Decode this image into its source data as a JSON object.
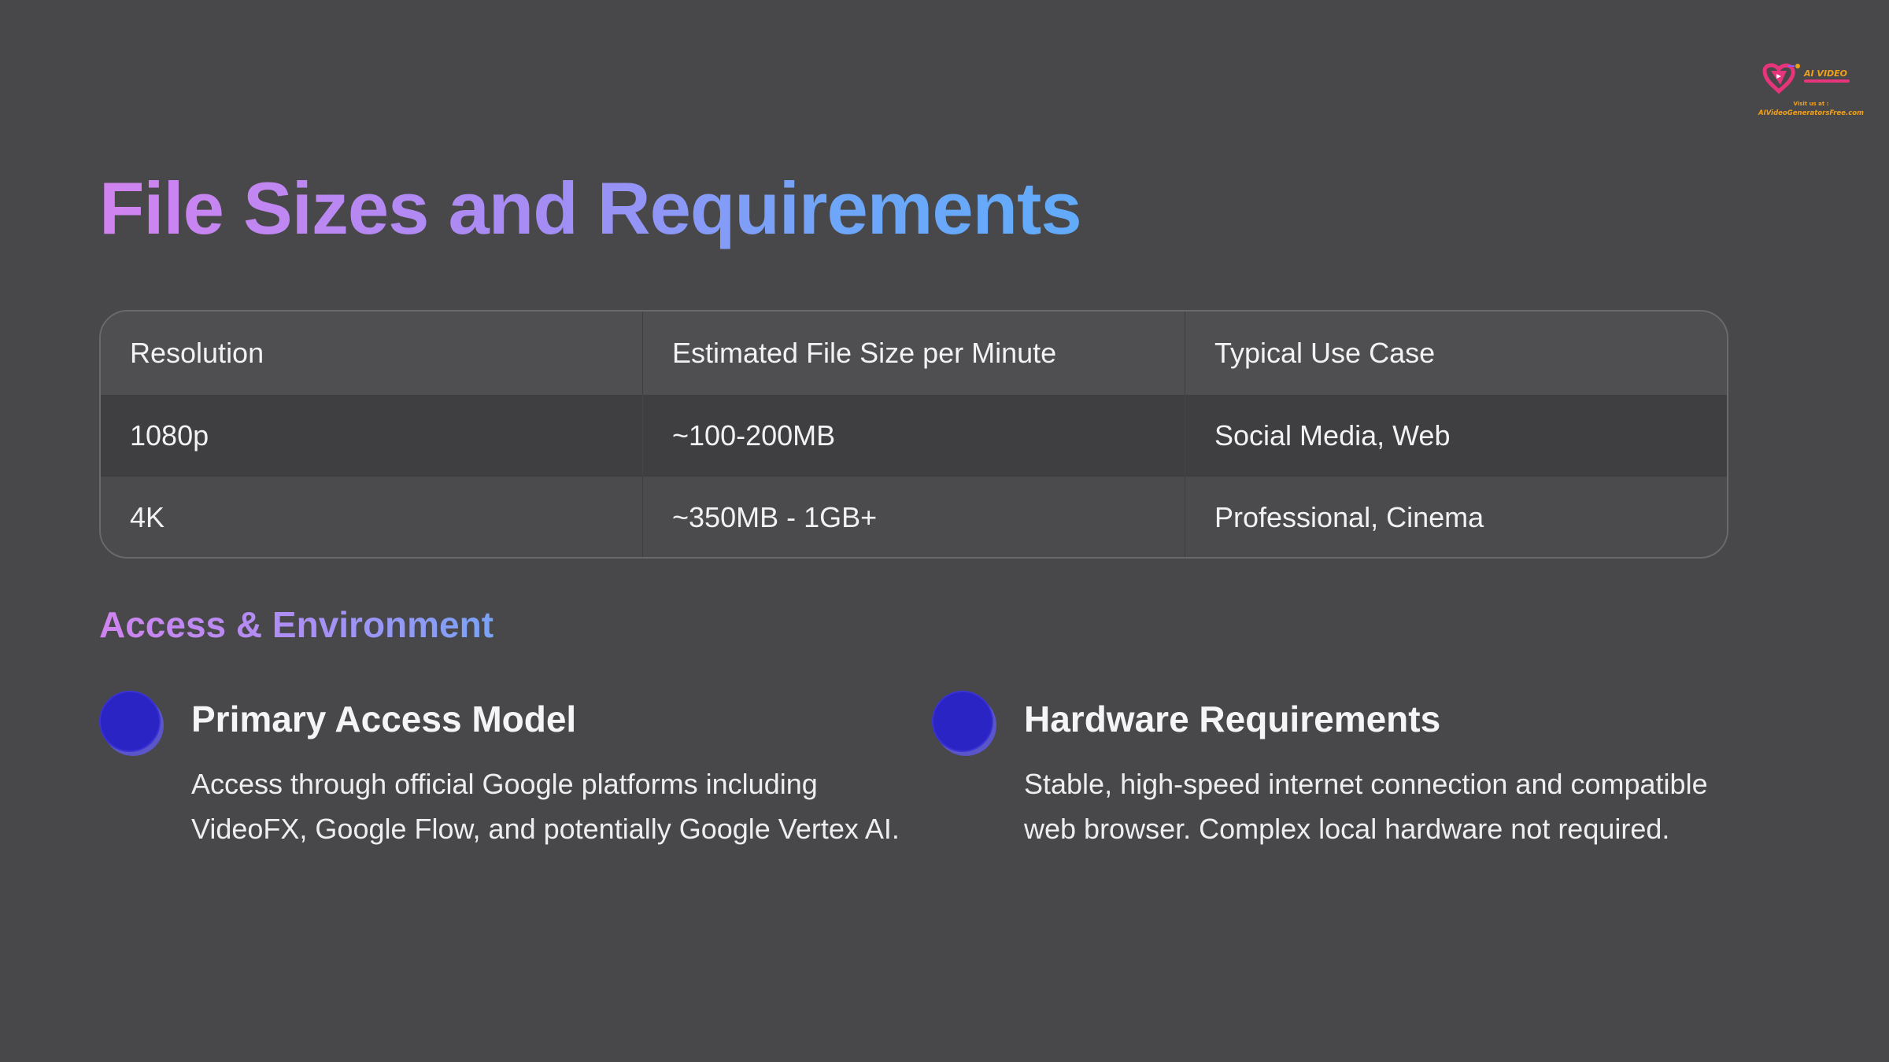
{
  "logo": {
    "brand": "AI VIDEO",
    "visit_label": "Visit us at :",
    "site": "AIVideoGeneratorsFree.com",
    "colors": {
      "primary": "#e6357a",
      "secondary": "#f0a11c"
    }
  },
  "title": "File Sizes and Requirements",
  "table": {
    "headers": [
      "Resolution",
      "Estimated File Size per Minute",
      "Typical Use Case"
    ],
    "rows": [
      [
        "1080p",
        "~100-200MB",
        "Social Media, Web"
      ],
      [
        "4K",
        "~350MB - 1GB+",
        "Professional, Cinema"
      ]
    ]
  },
  "section": {
    "heading": "Access & Environment",
    "items": [
      {
        "title": "Primary Access Model",
        "description": "Access through official Google platforms including VideoFX, Google Flow, and potentially Google Vertex AI."
      },
      {
        "title": "Hardware Requirements",
        "description": "Stable, high-speed internet connection and compatible web browser. Complex local hardware not required."
      }
    ]
  },
  "colors": {
    "background": "#484749",
    "title_gradient_start": "#d183f0",
    "title_gradient_end": "#62abfa",
    "bullet": "#2b24c4"
  }
}
